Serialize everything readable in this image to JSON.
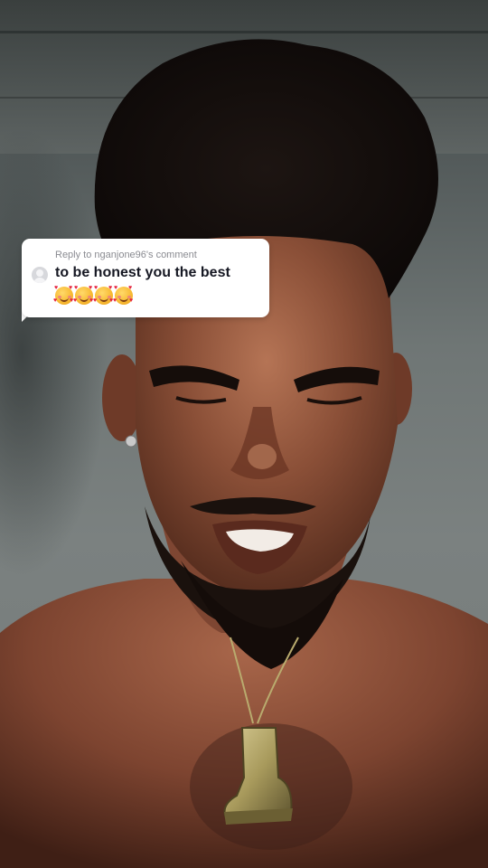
{
  "comment_reply": {
    "reply_to_label": "Reply to nganjone96's comment",
    "comment_text": "to be honest you the best",
    "emoji_name": "smiling-face-with-hearts",
    "emoji_count": 4
  },
  "colors": {
    "card_background": "#ffffff",
    "comment_text": "#161823",
    "reply_label": "#8a8b91"
  }
}
